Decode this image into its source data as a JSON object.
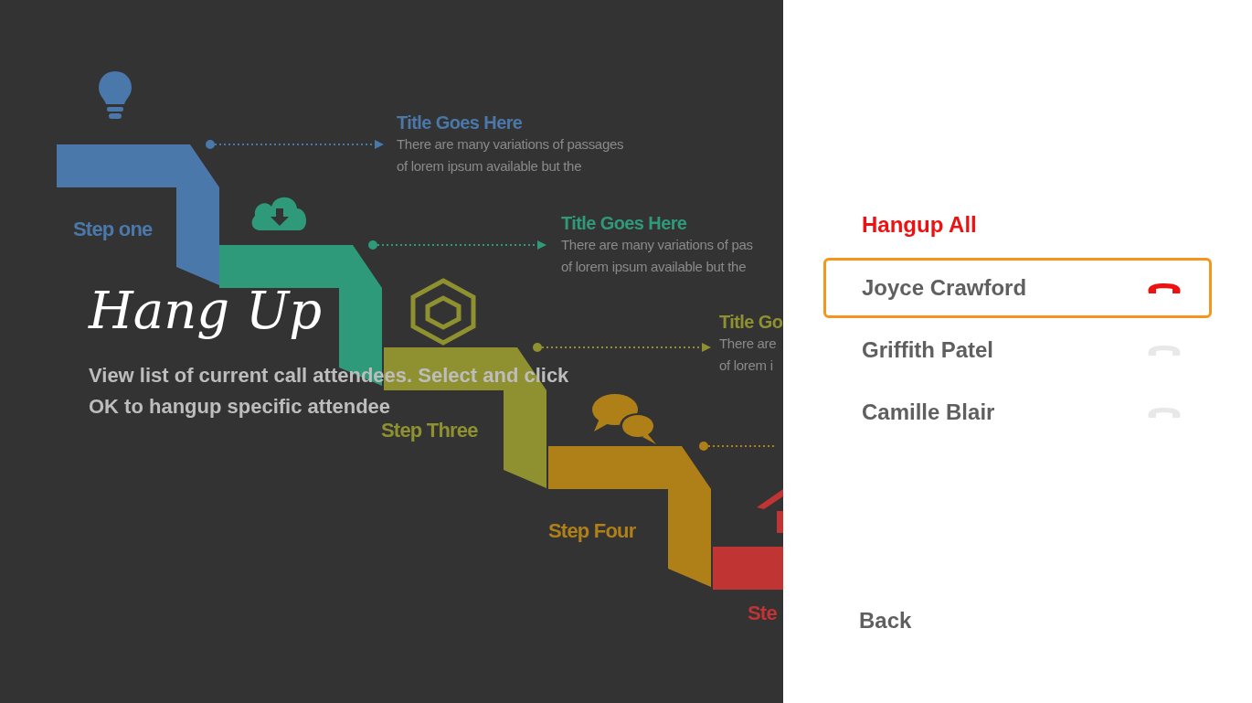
{
  "slide": {
    "steps": [
      {
        "label": "Step one",
        "color": "#4a78aa",
        "title": "Title Goes Here",
        "lines": [
          "There are many variations of passages",
          "of lorem ipsum available but the"
        ]
      },
      {
        "color": "#2f9a7a",
        "title": "Title Goes Here",
        "lines": [
          "There are many variations of pas",
          "of lorem ipsum available but the"
        ]
      },
      {
        "label": "Step Three",
        "color": "#8f9130",
        "title": "Title Go",
        "lines": [
          "There are",
          "of lorem i"
        ]
      },
      {
        "label": "Step Four",
        "color": "#b08018"
      },
      {
        "label": "Ste",
        "color": "#c03434"
      }
    ]
  },
  "overlay": {
    "title": "Hang Up",
    "description": "View list of current call attendees. Select and click OK to hangup specific attendee"
  },
  "menu": {
    "items": [
      {
        "kind": "action",
        "label": "Hangup All",
        "selected": false
      },
      {
        "kind": "attendee",
        "label": "Joyce Crawford",
        "selected": true
      },
      {
        "kind": "attendee",
        "label": "Griffith Patel",
        "selected": false
      },
      {
        "kind": "attendee",
        "label": "Camille Blair",
        "selected": false
      }
    ],
    "back": "Back"
  }
}
